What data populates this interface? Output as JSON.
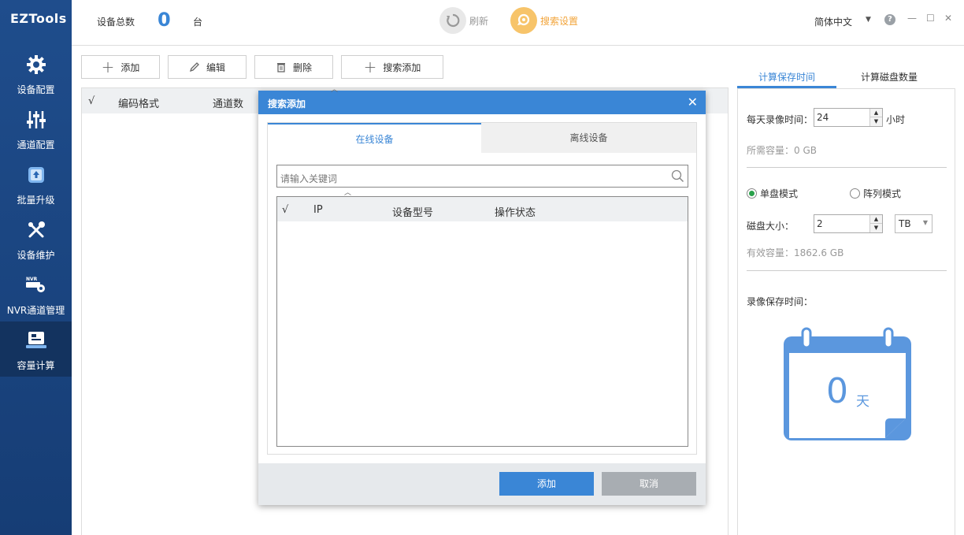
{
  "app": {
    "logo": "EZTools"
  },
  "sidebar": {
    "items": [
      {
        "label": "设备配置",
        "icon": "gear-icon"
      },
      {
        "label": "通道配置",
        "icon": "sliders-icon"
      },
      {
        "label": "批量升级",
        "icon": "upgrade-icon"
      },
      {
        "label": "设备维护",
        "icon": "tools-icon"
      },
      {
        "label": "NVR通道管理",
        "icon": "nvr-icon"
      },
      {
        "label": "容量计算",
        "icon": "calculator-icon",
        "active": true
      }
    ]
  },
  "topbar": {
    "device_total_label": "设备总数",
    "device_count": "0",
    "device_unit": "台",
    "refresh_label": "刷新",
    "search_settings_label": "搜索设置",
    "language": "简体中文",
    "help": "?",
    "minimize": "—",
    "maximize": "☐",
    "close": "✕"
  },
  "toolbar": {
    "add_label": "添加",
    "edit_label": "编辑",
    "delete_label": "删除",
    "search_add_label": "搜索添加"
  },
  "main_table": {
    "columns": [
      "√",
      "编码格式",
      "通道数"
    ]
  },
  "right_panel": {
    "tabs": [
      "计算保存时间",
      "计算磁盘数量"
    ],
    "daily_record_label": "每天录像时间：",
    "daily_record_value": "24",
    "daily_record_unit": "小时",
    "required_capacity": "所需容量：0 GB",
    "mode_single": "单盘模式",
    "mode_array": "阵列模式",
    "disk_size_label": "磁盘大小：",
    "disk_size_value": "2",
    "disk_size_unit": "TB",
    "effective_capacity": "有效容量：1862.6 GB",
    "retention_label": "录像保存时间：",
    "retention_days": "0",
    "retention_unit": "天"
  },
  "dialog": {
    "title": "搜索添加",
    "close": "✕",
    "tabs": [
      "在线设备",
      "离线设备"
    ],
    "search_placeholder": "请输入关键词",
    "columns": [
      "√",
      "IP",
      "设备型号",
      "操作状态"
    ],
    "add_button": "添加",
    "cancel_button": "取消"
  },
  "colors": {
    "sidebar_bg": "#1f4d8c",
    "accent_blue": "#3a86d6",
    "accent_orange": "#f2a43a",
    "radio_green": "#2aa14b",
    "cancel_gray": "#a8adb2"
  }
}
